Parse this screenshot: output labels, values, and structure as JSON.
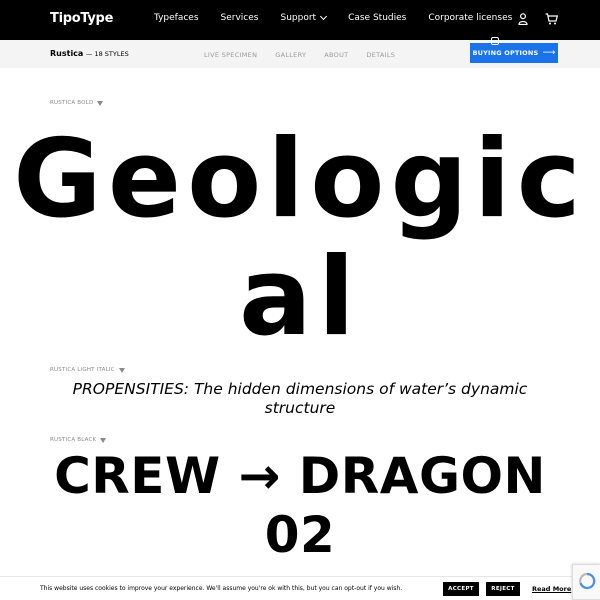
{
  "nav": {
    "logo": "TipoType",
    "links": [
      "Typefaces",
      "Services",
      "Support",
      "Case Studies",
      "Corporate licenses"
    ],
    "user_icon": "user-icon",
    "cart_icon": "cart-icon"
  },
  "subnav": {
    "family": "Rustica",
    "styles": "— 18 STYLES",
    "links": [
      "LIVE SPECIMEN",
      "GALLERY",
      "ABOUT",
      "DETAILS"
    ],
    "buy_button": "BUYING OPTIONS"
  },
  "specimens": [
    {
      "label": "RUSTICA BOLD",
      "text_line1": "Geologic",
      "text_line2": "al"
    },
    {
      "label": "RUSTICA LIGHT ITALIC",
      "text": "PROPENSITIES: The hidden dimensions of water’s dynamic structure"
    },
    {
      "label": "RUSTICA BLACK",
      "text_line1": "CREW → DRAGON",
      "text_line2": "02"
    }
  ],
  "cookie": {
    "message": "This website uses cookies to improve your experience. We'll assume you're ok with this, but you can opt-out if you wish.",
    "accept": "ACCEPT",
    "reject": "REJECT",
    "read_more": "Read More"
  },
  "colors": {
    "nav_bg": "#000000",
    "accent": "#1a73e8",
    "subnav_bg": "#f4f4f4"
  }
}
